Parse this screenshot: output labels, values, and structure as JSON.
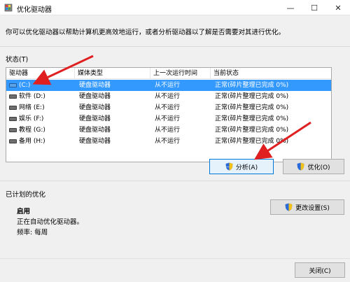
{
  "window": {
    "title": "优化驱动器",
    "min_glyph": "—",
    "max_glyph": "☐",
    "close_glyph": "✕"
  },
  "intro_text": "你可以优化驱动器以帮助计算机更高效地运行，或者分析驱动器以了解是否需要对其进行优化。",
  "status_label": "状态(T)",
  "table": {
    "headers": [
      "驱动器",
      "媒体类型",
      "上一次运行时间",
      "当前状态"
    ],
    "rows": [
      {
        "drive": "(C:)",
        "media": "硬盘驱动器",
        "last_run": "从不运行",
        "status": "正常(碎片整理已完成 0%)",
        "selected": true,
        "system": true
      },
      {
        "drive": "软件 (D:)",
        "media": "硬盘驱动器",
        "last_run": "从不运行",
        "status": "正常(碎片整理已完成 0%)"
      },
      {
        "drive": "网络 (E:)",
        "media": "硬盘驱动器",
        "last_run": "从不运行",
        "status": "正常(碎片整理已完成 0%)"
      },
      {
        "drive": "娱乐 (F:)",
        "media": "硬盘驱动器",
        "last_run": "从不运行",
        "status": "正常(碎片整理已完成 0%)"
      },
      {
        "drive": "教程 (G:)",
        "media": "硬盘驱动器",
        "last_run": "从不运行",
        "status": "正常(碎片整理已完成 0%)"
      },
      {
        "drive": "备用 (H:)",
        "media": "硬盘驱动器",
        "last_run": "从不运行",
        "status": "正常(碎片整理已完成 0%)"
      }
    ]
  },
  "buttons": {
    "analyze": "分析(A)",
    "optimize": "优化(O)",
    "change_settings": "更改设置(S)",
    "close": "关闭(C)"
  },
  "scheduled": {
    "label": "已计划的优化",
    "enabled": "启用",
    "auto": "正在自动优化驱动器。",
    "frequency": "频率: 每周"
  },
  "colors": {
    "selection": "#3399ff",
    "arrow": "#e02020",
    "shield_blue": "#2a6ad8",
    "shield_yellow": "#f2c21b"
  }
}
